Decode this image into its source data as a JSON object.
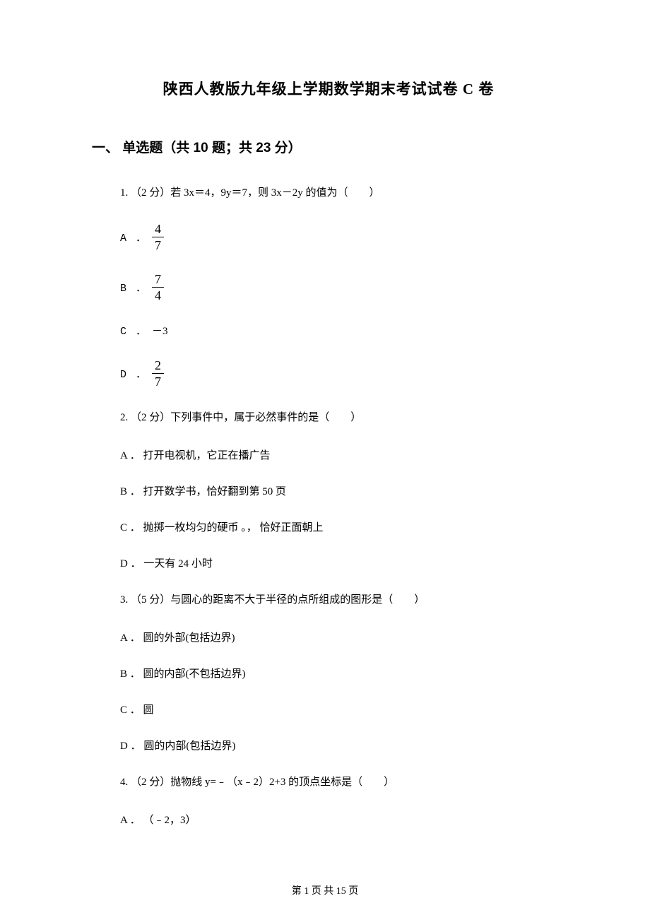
{
  "title": "陕西人教版九年级上学期数学期末考试试卷 C 卷",
  "section": {
    "header": "一、 单选题（共 10 题；共 23 分）"
  },
  "q1": {
    "text": "1. （2 分）若 3x＝4，9y＝7，则 3x－2y 的值为（　　）",
    "optA_label": "A ．",
    "optA_num": "4",
    "optA_den": "7",
    "optB_label": "B ．",
    "optB_num": "7",
    "optB_den": "4",
    "optC_label": "C ．",
    "optC_text": "－3",
    "optD_label": "D ．",
    "optD_num": "2",
    "optD_den": "7"
  },
  "q2": {
    "text": "2. （2 分）下列事件中，属于必然事件的是（　　）",
    "optA": "A ． 打开电视机，它正在播广告",
    "optB": "B ． 打开数学书，恰好翻到第 50 页",
    "optC": "C ． 抛掷一枚均匀的硬币 。， 恰好正面朝上",
    "optD": "D ． 一天有 24 小时"
  },
  "q3": {
    "text": "3. （5 分）与圆心的距离不大于半径的点所组成的图形是（　　）",
    "optA": "A ． 圆的外部(包括边界)",
    "optB": "B ． 圆的内部(不包括边界)",
    "optC": "C ． 圆",
    "optD": "D ． 圆的内部(包括边界)"
  },
  "q4": {
    "text": "4. （2 分）抛物线 y=﹣（x﹣2）2+3 的顶点坐标是（　　）",
    "optA": "A ． （﹣2，3）"
  },
  "footer": "第 1 页 共 15 页"
}
